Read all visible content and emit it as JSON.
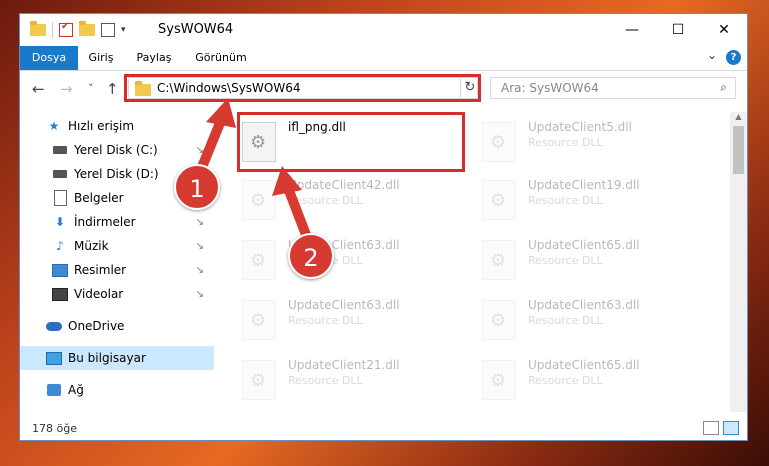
{
  "window": {
    "title": "SysWOW64",
    "controls": {
      "minimize": "—",
      "maximize": "☐",
      "close": "✕"
    }
  },
  "ribbon": {
    "tabs": [
      "Dosya",
      "Giriş",
      "Paylaş",
      "Görünüm"
    ],
    "help": "?"
  },
  "nav": {
    "back": "←",
    "forward": "→",
    "recent": "˅",
    "up": "↑",
    "address": "C:\\Windows\\SysWOW64",
    "address_dropdown": "˅",
    "refresh": "↻",
    "search_placeholder": "Ara: SysWOW64",
    "search_icon": "⌕"
  },
  "sidebar": {
    "items": [
      {
        "label": "Hızlı erişim",
        "icon": "star-icon"
      },
      {
        "label": "Yerel Disk (C:)",
        "icon": "drive-icon",
        "pin": "↘"
      },
      {
        "label": "Yerel Disk (D:)",
        "icon": "drive-icon"
      },
      {
        "label": "Belgeler",
        "icon": "document-icon",
        "pin": "↘"
      },
      {
        "label": "İndirmeler",
        "icon": "download-icon",
        "pin": "↘"
      },
      {
        "label": "Müzik",
        "icon": "music-icon",
        "pin": "↘"
      },
      {
        "label": "Resimler",
        "icon": "pictures-icon",
        "pin": "↘"
      },
      {
        "label": "Videolar",
        "icon": "videos-icon",
        "pin": "↘"
      },
      {
        "label": "OneDrive",
        "icon": "cloud-icon"
      },
      {
        "label": "Bu bilgisayar",
        "icon": "computer-icon",
        "selected": true
      },
      {
        "label": "Ağ",
        "icon": "network-icon"
      }
    ]
  },
  "files": [
    {
      "name": "ifl_png.dll",
      "type": ""
    },
    {
      "name": "UpdateClient5.dll",
      "type": "Resource DLL"
    },
    {
      "name": "UpdateClient42.dll",
      "type": "Resource DLL"
    },
    {
      "name": "UpdateClient19.dll",
      "type": "Resource DLL"
    },
    {
      "name": "UpdateClient63.dll",
      "type": "Resource DLL"
    },
    {
      "name": "UpdateClient65.dll",
      "type": "Resource DLL"
    },
    {
      "name": "UpdateClient63.dll",
      "type": "Resource DLL"
    },
    {
      "name": "UpdateClient63.dll",
      "type": "Resource DLL"
    },
    {
      "name": "UpdateClient21.dll",
      "type": "Resource DLL"
    },
    {
      "name": "UpdateClient65.dll",
      "type": "Resource DLL"
    }
  ],
  "status": {
    "count": "178 öğe"
  },
  "annotations": {
    "marker1": "1",
    "marker2": "2"
  }
}
